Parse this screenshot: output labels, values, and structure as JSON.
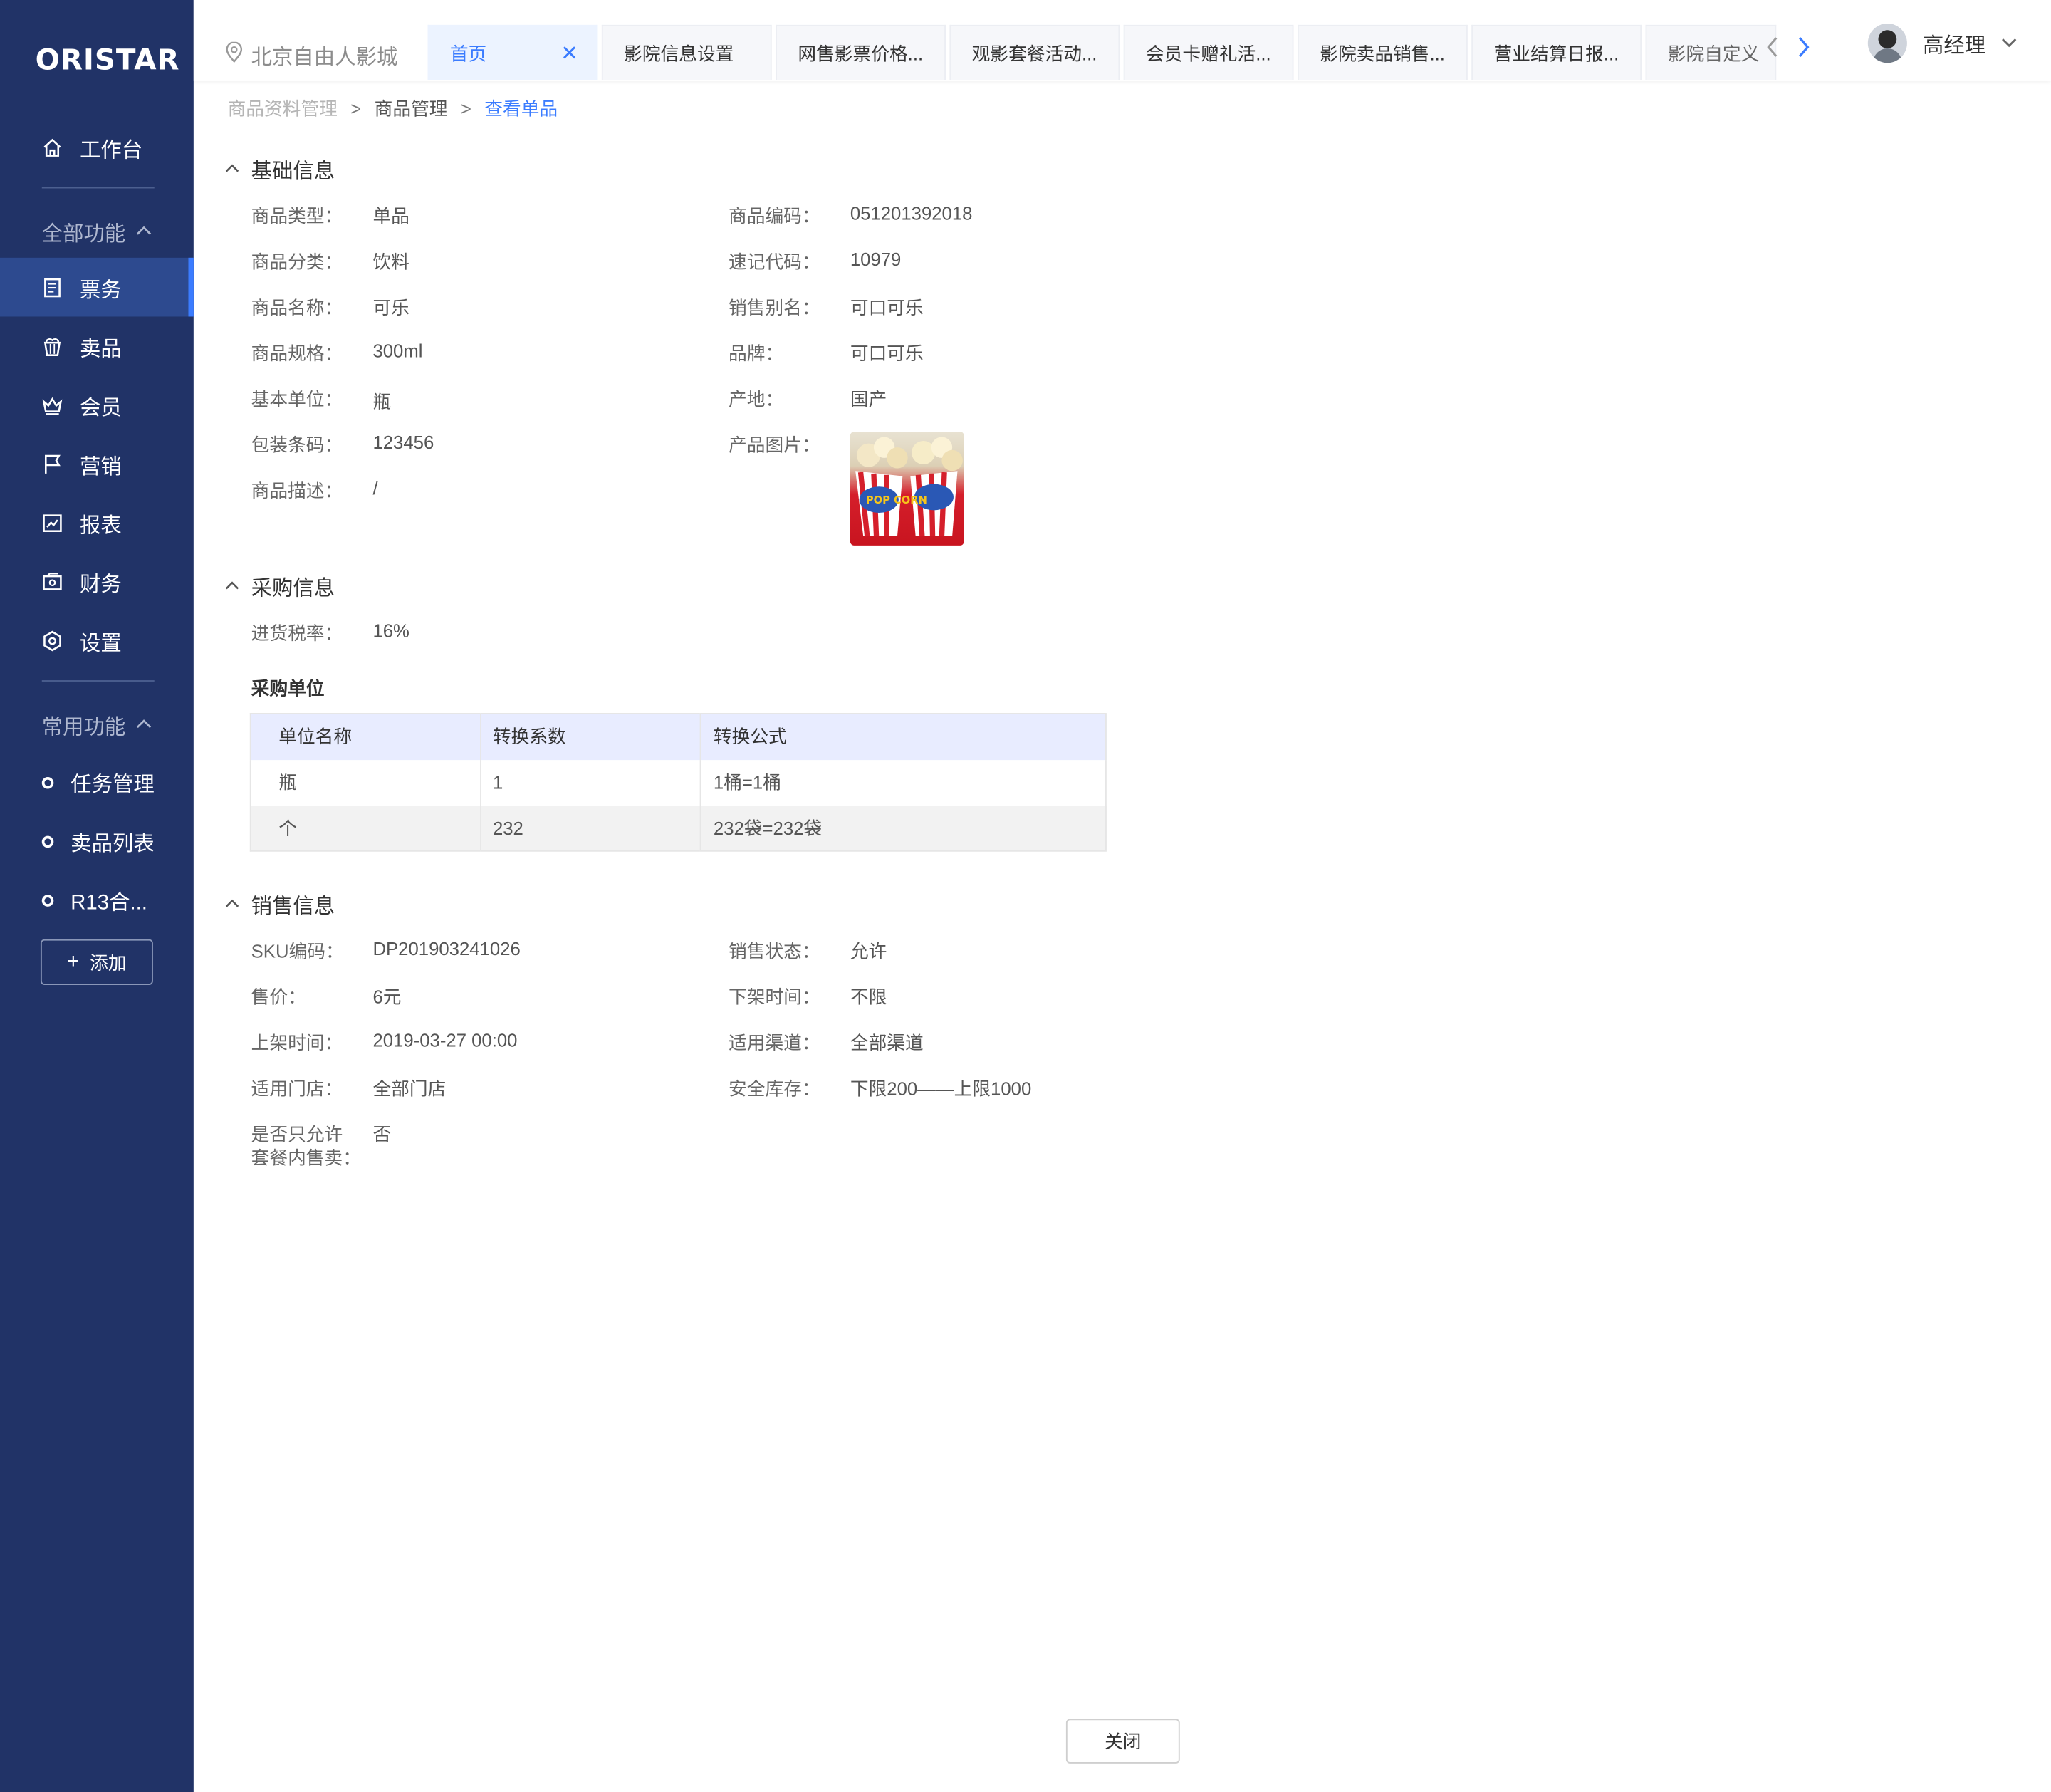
{
  "sidebar": {
    "logo": "ORISTAR",
    "workbench": "工作台",
    "all_features": "全部功能",
    "items": [
      {
        "label": "票务",
        "icon": "ticket-icon"
      },
      {
        "label": "卖品",
        "icon": "popcorn-icon"
      },
      {
        "label": "会员",
        "icon": "crown-icon"
      },
      {
        "label": "营销",
        "icon": "flag-icon"
      },
      {
        "label": "报表",
        "icon": "report-icon"
      },
      {
        "label": "财务",
        "icon": "finance-icon"
      },
      {
        "label": "设置",
        "icon": "gear-icon"
      }
    ],
    "common_features": "常用功能",
    "favorites": [
      "任务管理",
      "卖品列表",
      "R13合..."
    ],
    "add_label": "添加"
  },
  "topbar": {
    "location": "北京自由人影城",
    "tabs": [
      "首页",
      "影院信息设置",
      "网售影票价格...",
      "观影套餐活动...",
      "会员卡赠礼活...",
      "影院卖品销售...",
      "营业结算日报...",
      "影院自定义"
    ],
    "user_name": "高经理"
  },
  "breadcrumb": [
    "商品资料管理",
    "商品管理",
    "查看单品"
  ],
  "basic": {
    "title": "基础信息",
    "left": [
      {
        "label": "商品类型：",
        "value": "单品"
      },
      {
        "label": "商品分类：",
        "value": "饮料"
      },
      {
        "label": "商品名称：",
        "value": "可乐"
      },
      {
        "label": "商品规格：",
        "value": "300ml"
      },
      {
        "label": "基本单位：",
        "value": "瓶"
      },
      {
        "label": "包装条码：",
        "value": "123456"
      },
      {
        "label": "商品描述：",
        "value": "/"
      }
    ],
    "right": [
      {
        "label": "商品编码：",
        "value": "051201392018"
      },
      {
        "label": "速记代码：",
        "value": "10979"
      },
      {
        "label": "销售别名：",
        "value": "可口可乐"
      },
      {
        "label": "品牌：",
        "value": "可口可乐"
      },
      {
        "label": "产地：",
        "value": "国产"
      },
      {
        "label": "产品图片：",
        "value": ""
      }
    ],
    "image_text": "POP CORN"
  },
  "purchase": {
    "title": "采购信息",
    "tax_label": "进货税率：",
    "tax_value": "16%",
    "units_title": "采购单位",
    "columns": [
      "单位名称",
      "转换系数",
      "转换公式"
    ],
    "rows": [
      [
        "瓶",
        "1",
        "1桶=1桶"
      ],
      [
        "个",
        "232",
        "232袋=232袋"
      ]
    ]
  },
  "sales": {
    "title": "销售信息",
    "left": [
      {
        "label": "SKU编码：",
        "value": "DP201903241026"
      },
      {
        "label": "售价：",
        "value": "6元"
      },
      {
        "label": "上架时间：",
        "value": "2019-03-27 00:00"
      },
      {
        "label": "适用门店：",
        "value": "全部门店"
      },
      {
        "label": "是否只允许",
        "value": "否"
      }
    ],
    "left_extra_label": "套餐内售卖：",
    "right": [
      {
        "label": "销售状态：",
        "value": "允许"
      },
      {
        "label": "下架时间：",
        "value": "不限"
      },
      {
        "label": "适用渠道：",
        "value": "全部渠道"
      },
      {
        "label": "安全库存：",
        "value": "下限200——上限1000"
      }
    ]
  },
  "close_label": "关闭",
  "colors": {
    "sidebar": "#213367",
    "accent": "#3b7cff",
    "table_header": "#e8ecff"
  }
}
